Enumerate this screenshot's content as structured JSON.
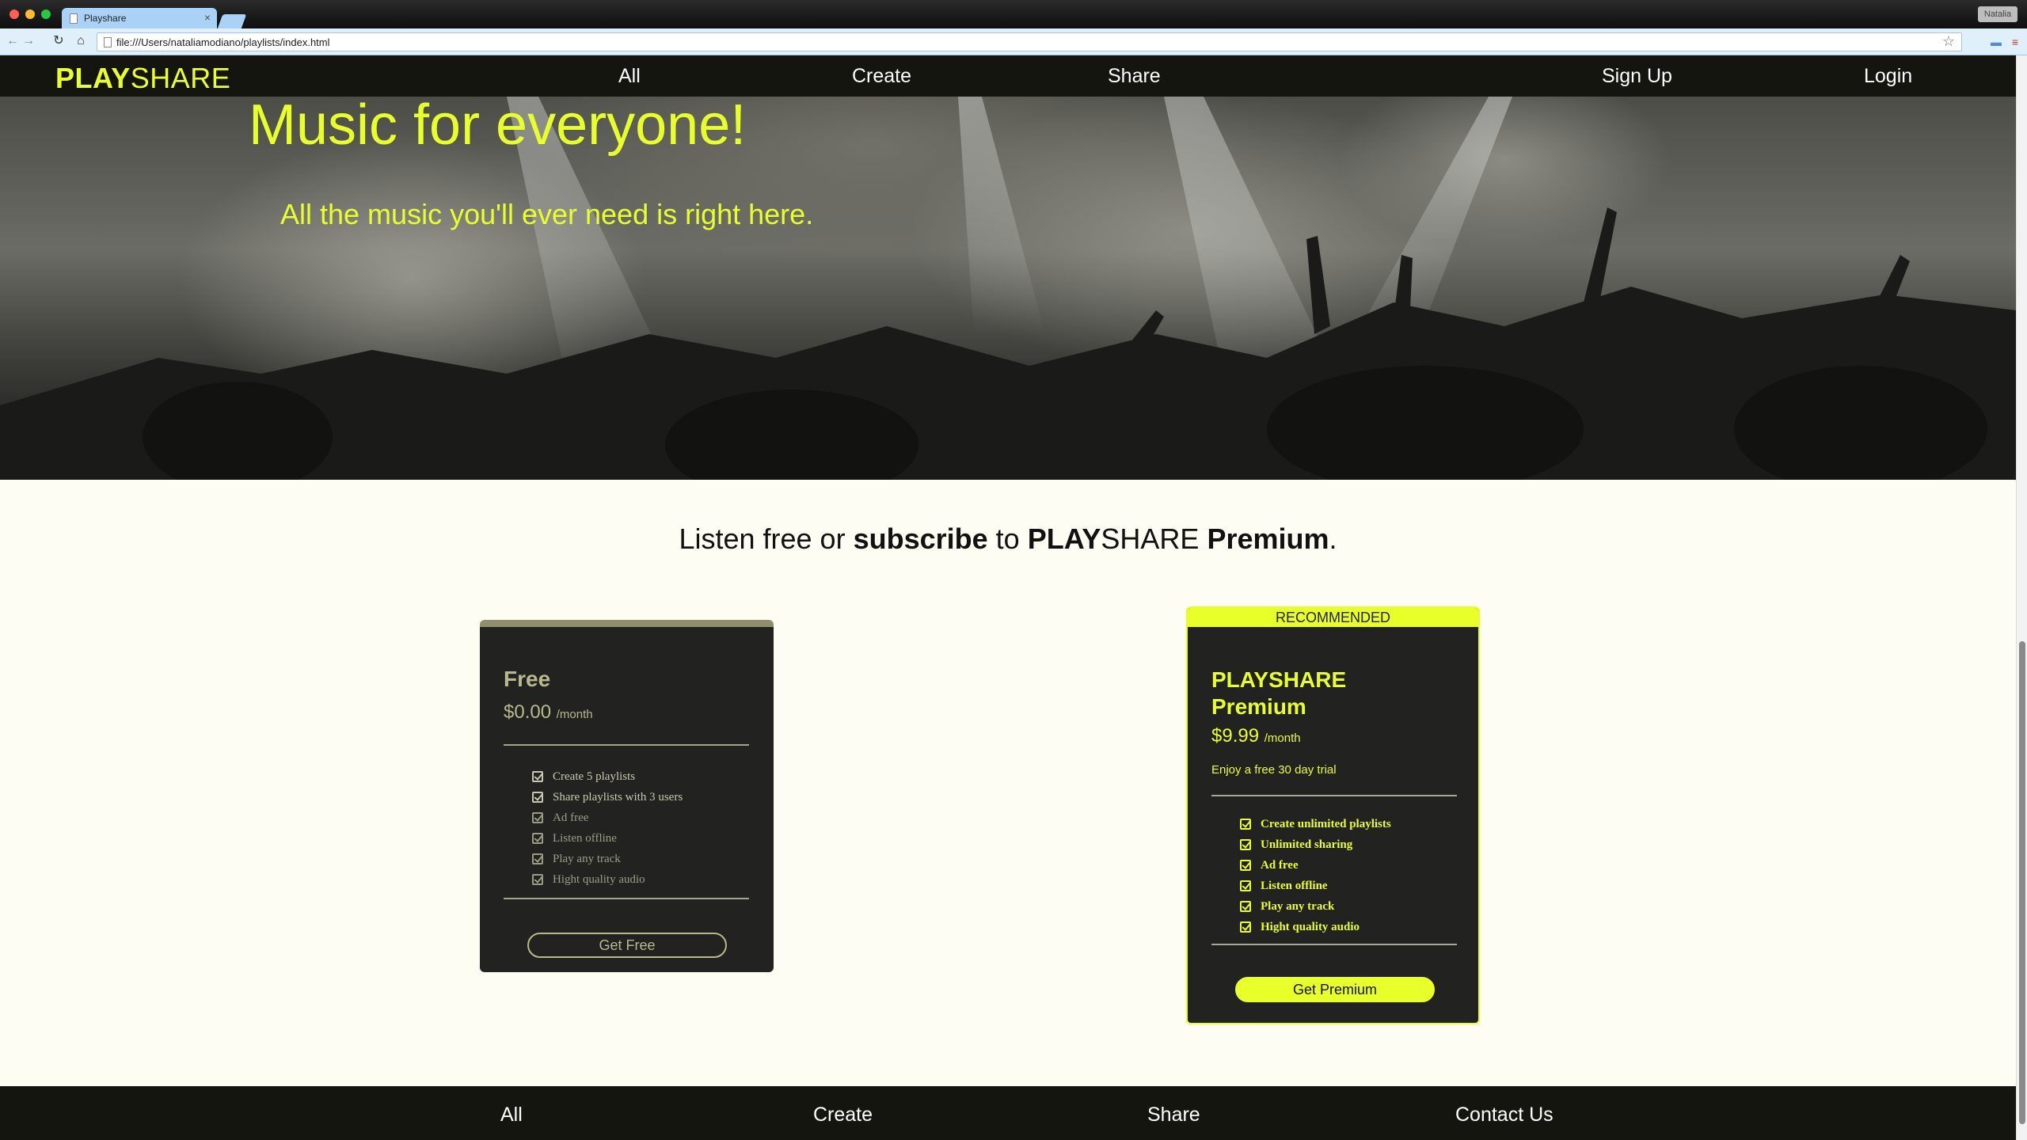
{
  "browser": {
    "tab_title": "Playshare",
    "url": "file:///Users/nataliamodiano/playlists/index.html",
    "profile_name": "Natalia"
  },
  "site": {
    "logo_bold": "PLAY",
    "logo_light": "SHARE",
    "accent_color": "#e8ff2a",
    "nav": {
      "all": "All",
      "create": "Create",
      "share": "Share",
      "signup": "Sign Up",
      "login": "Login"
    }
  },
  "hero": {
    "title": "Music for everyone!",
    "subtitle": "All the music you'll ever need is right here."
  },
  "pricing": {
    "heading": {
      "t1": "Listen free or ",
      "t2": "subscribe",
      "t3": " to ",
      "t4": "PLAY",
      "t5": "SHARE ",
      "t6": "Premium",
      "t7": "."
    },
    "free": {
      "name": "Free",
      "price": "$0.00",
      "period": "/month",
      "features": [
        "Create 5 playlists",
        "Share playlists with 3 users",
        "Ad free",
        "Listen offline",
        "Play any track",
        "Hight quality audio"
      ],
      "cta": "Get Free"
    },
    "premium": {
      "badge": "RECOMMENDED",
      "name_line1": "PLAYSHARE",
      "name_line2": "Premium",
      "price": "$9.99",
      "period": "/month",
      "trial": "Enjoy a free 30 day trial",
      "features": [
        "Create unlimited playlists",
        "Unlimited sharing",
        "Ad free",
        "Listen offline",
        "Play any track",
        "Hight quality audio"
      ],
      "cta": "Get Premium"
    }
  },
  "footer": {
    "all": "All",
    "create": "Create",
    "share": "Share",
    "contact": "Contact Us"
  }
}
